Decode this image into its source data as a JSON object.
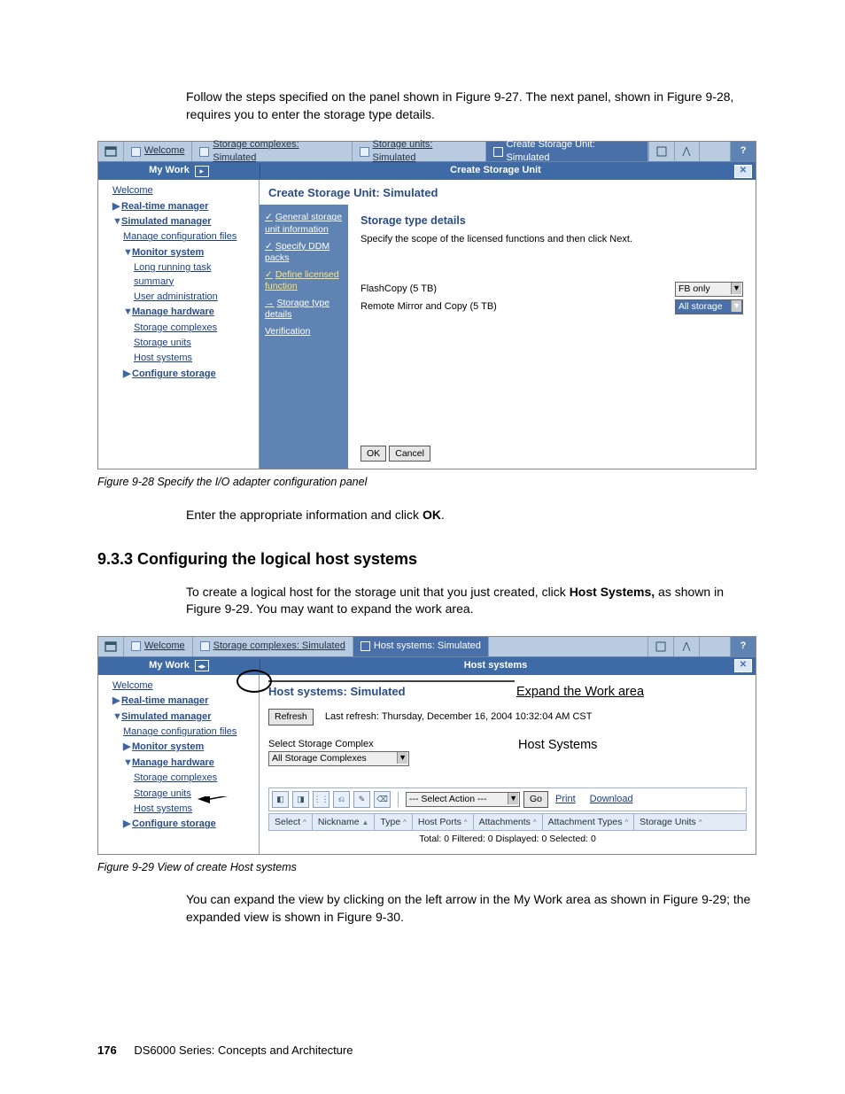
{
  "intro": "Follow the steps specified on the panel shown in Figure 9-27. The next panel, shown in Figure 9-28, requires you to enter the storage type details.",
  "cap1": "Figure 9-28   Specify the I/O adapter configuration panel",
  "after1_a": "Enter the appropriate information and click ",
  "after1_ok": "OK",
  "after1_b": ".",
  "section": "9.3.3  Configuring the logical host systems",
  "intro2_a": "To create a logical host for the storage unit that you just created, click ",
  "intro2_hs": "Host Systems,",
  "intro2_b": " as shown in Figure 9-29. You may want to expand the work area.",
  "cap2": "Figure 9-29   View of create Host systems",
  "after2": "You can expand the view by clicking on the left arrow in the My Work area as shown in Figure 9-29; the expanded view is shown in Figure 9-30.",
  "footer_page": "176",
  "footer_title": "DS6000 Series: Concepts and Architecture",
  "s1": {
    "tabs": {
      "welcome": "Welcome",
      "sc": "Storage complexes: Simulated",
      "su": "Storage units: Simulated",
      "active": "Create Storage Unit: Simulated"
    },
    "mywork": "My Work",
    "header_main": "Create Storage Unit",
    "side": {
      "welcome": "Welcome",
      "rtm": "Real-time manager",
      "sm": "Simulated manager",
      "mcf": "Manage configuration files",
      "ms": "Monitor system",
      "lrts": "Long running task summary",
      "ua": "User administration",
      "mh": "Manage hardware",
      "sc": "Storage complexes",
      "su": "Storage units",
      "hs": "Host systems",
      "cs": "Configure storage"
    },
    "title": "Create Storage Unit: Simulated",
    "steps": {
      "g": "General storage unit information",
      "ddm": "Specify DDM packs",
      "lic": "Define licensed function",
      "std": "Storage type details",
      "ver": "Verification"
    },
    "pane": {
      "h": "Storage type details",
      "sub": "Specify the scope of the licensed functions and then click Next.",
      "r1l": "FlashCopy (5 TB)",
      "r1v": "FB only",
      "r2l": "Remote Mirror and Copy (5 TB)",
      "r2v": "All storage",
      "ok": "OK",
      "cancel": "Cancel"
    }
  },
  "s2": {
    "tabs": {
      "welcome": "Welcome",
      "sc": "Storage complexes: Simulated",
      "active": "Host systems: Simulated"
    },
    "mywork": "My Work",
    "header_main": "Host systems",
    "side": {
      "welcome": "Welcome",
      "rtm": "Real-time manager",
      "sm": "Simulated manager",
      "mcf": "Manage configuration files",
      "ms": "Monitor system",
      "mh": "Manage hardware",
      "sc": "Storage complexes",
      "su": "Storage units",
      "hs": "Host systems",
      "cs": "Configure storage"
    },
    "title": "Host systems: Simulated",
    "refresh": "Refresh",
    "last": "Last refresh: Thursday, December 16, 2004 10:32:04 AM CST",
    "ssc_label": "Select Storage Complex",
    "ssc_value": "All Storage Complexes",
    "action_sel": "--- Select Action ---",
    "go": "Go",
    "print": "Print",
    "download": "Download",
    "cols": {
      "select": "Select",
      "nick": "Nickname",
      "type": "Type",
      "hp": "Host Ports",
      "att": "Attachments",
      "atty": "Attachment Types",
      "su": "Storage Units"
    },
    "status": "Total: 0    Filtered: 0    Displayed: 0    Selected: 0",
    "ann_expand": "Expand the Work area",
    "ann_hs": "Host Systems"
  }
}
